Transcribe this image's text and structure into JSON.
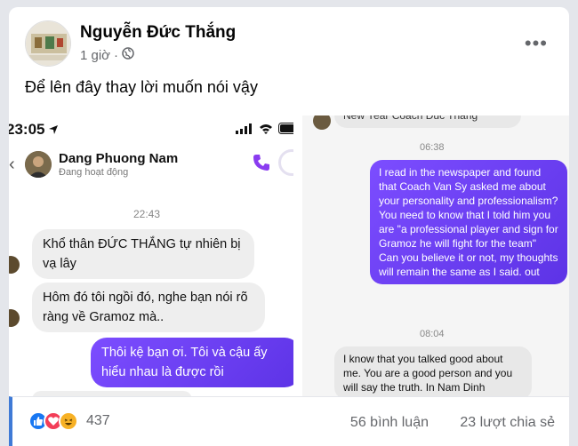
{
  "post": {
    "author": "Nguyễn Đức Thắng",
    "time": "1 giờ",
    "caption": "Để lên đây thay lời muốn nói vậy"
  },
  "left_chat": {
    "status_time": "23:05",
    "contact_name": "Dang Phuong Nam",
    "contact_status": "Đang hoạt động",
    "timestamp": "22:43",
    "messages": [
      "Khổ thân ĐỨC THẮNG tự nhiên bị vạ lây",
      "Hôm đó tôi ngồi đó, nghe bạn nói rõ ràng về Gramoz mà..",
      "Thôi kệ bạn ơi. Tôi và cậu ấy hiểu nhau là được rồi"
    ]
  },
  "right_chat": {
    "top_partial": "New Year Coach Duc Thang",
    "timestamp_1": "06:38",
    "message_out": "I read in the newspaper and found that Coach Van Sy asked me about your personality and professionalism? You need to know that I told him you are \"a professional player and sign for Gramoz he will fight for the team\" Can you believe it or not, my thoughts will remain the same as I said. out",
    "timestamp_2": "08:04",
    "message_in": "I know that you talked good about me. You are a good person and you will say the truth. In Nam Dinh"
  },
  "footer": {
    "reaction_count": "437",
    "comments": "56 bình luận",
    "shares": "23 lượt chia sẻ"
  },
  "icons": {
    "like": "like-icon",
    "love": "love-icon",
    "haha": "haha-icon",
    "globe": "globe-icon",
    "more": "more-options-icon"
  },
  "colors": {
    "accent": "#3f7ad6",
    "bubble_out": "#6a3ef0",
    "like": "#1877f2",
    "love": "#f33e58",
    "haha": "#f7b125"
  }
}
